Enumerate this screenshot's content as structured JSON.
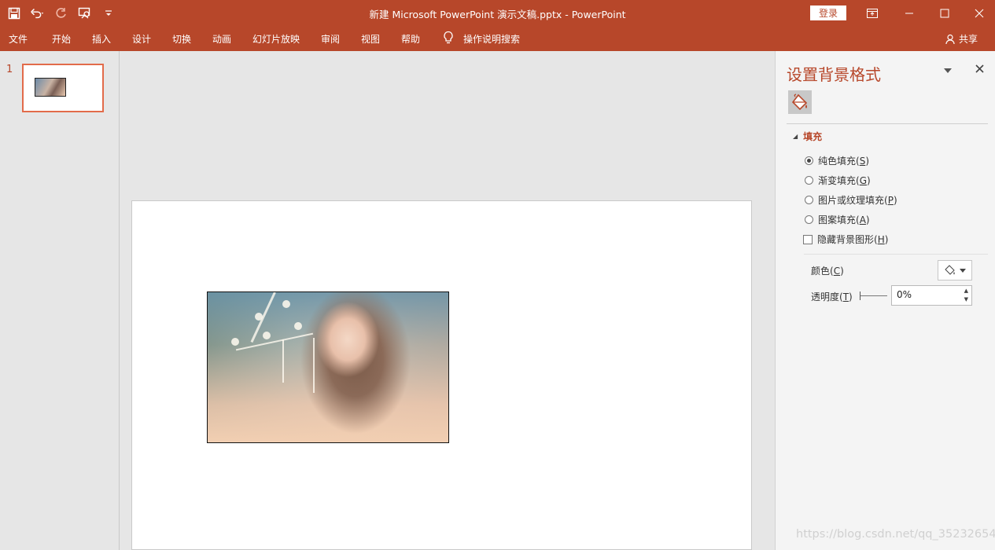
{
  "window": {
    "title": "新建 Microsoft PowerPoint 演示文稿.pptx  -  PowerPoint",
    "login_label": "登录"
  },
  "quick_access": [
    "save-icon",
    "undo-icon",
    "redo-icon",
    "presenter-icon",
    "customize-icon"
  ],
  "menu": {
    "items": [
      "文件",
      "开始",
      "插入",
      "设计",
      "切换",
      "动画",
      "幻灯片放映",
      "审阅",
      "视图",
      "帮助"
    ],
    "tell_me": "操作说明搜索",
    "share": "共享"
  },
  "thumbnails": {
    "slide_number": "1"
  },
  "panel": {
    "title": "设置背景格式",
    "section": "填充",
    "options": [
      {
        "label": "纯色填充(",
        "key": "S",
        "suffix": ")",
        "type": "radio",
        "selected": true
      },
      {
        "label": "渐变填充(",
        "key": "G",
        "suffix": ")",
        "type": "radio",
        "selected": false
      },
      {
        "label": "图片或纹理填充(",
        "key": "P",
        "suffix": ")",
        "type": "radio",
        "selected": false
      },
      {
        "label": "图案填充(",
        "key": "A",
        "suffix": ")",
        "type": "radio",
        "selected": false
      },
      {
        "label": "隐藏背景图形(",
        "key": "H",
        "suffix": ")",
        "type": "checkbox",
        "selected": false
      }
    ],
    "color_label": "颜色(",
    "color_key": "C",
    "color_suffix": ")",
    "transparency_label": "透明度(",
    "transparency_key": "T",
    "transparency_suffix": ")",
    "transparency_value": "0%"
  },
  "watermark": "https://blog.csdn.net/qq_35232654",
  "colors": {
    "accent": "#b7472a",
    "thumb_border": "#e26b4a"
  }
}
